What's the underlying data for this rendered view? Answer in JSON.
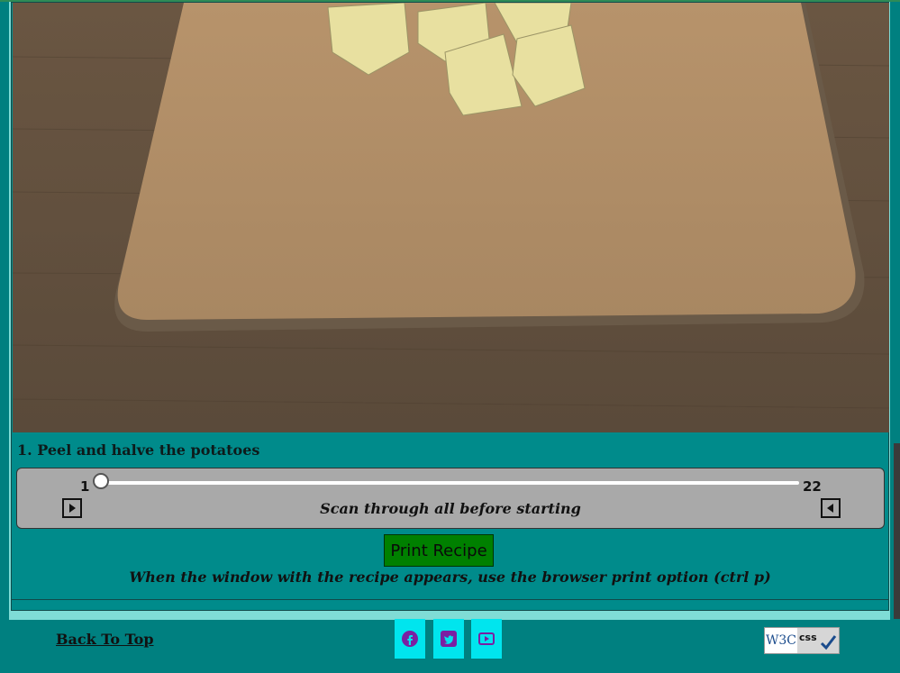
{
  "step": {
    "text": "1. Peel and halve the potatoes",
    "current": 1,
    "total": 22
  },
  "slider": {
    "min_label": "1",
    "max_label": "22",
    "hint": "Scan through all before starting",
    "prev_icon": "play-right-icon",
    "next_icon": "play-left-icon"
  },
  "print": {
    "button_label": "Print Recipe",
    "note": "When the window with the recipe appears, use the browser print option (ctrl p)"
  },
  "footer": {
    "back_to_top": "Back To Top",
    "social": [
      "facebook-icon",
      "twitter-icon",
      "youtube-icon"
    ],
    "badge_left": "W3C",
    "badge_right": "css"
  },
  "colors": {
    "background": "#008080",
    "card": "#008b8b",
    "print_button": "#008000",
    "social_button": "#00e5ee",
    "social_icon": "#7b1fa2"
  }
}
